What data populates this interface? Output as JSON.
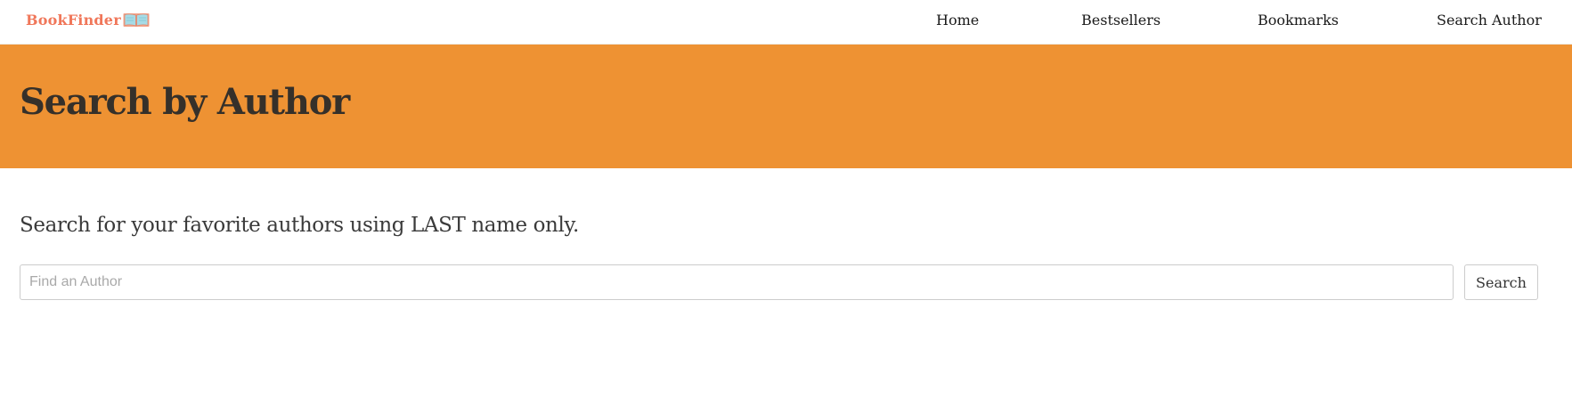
{
  "brand": {
    "name": "BookFinder",
    "icon": "open-book-icon",
    "color": "#f0775a"
  },
  "nav": {
    "items": [
      {
        "label": "Home"
      },
      {
        "label": "Bestsellers"
      },
      {
        "label": "Bookmarks"
      },
      {
        "label": "Search Author"
      }
    ]
  },
  "header": {
    "title": "Search by Author",
    "background": "#ee9233"
  },
  "main": {
    "lead": "Search for your favorite authors using LAST name only.",
    "search": {
      "placeholder": "Find an Author",
      "value": "",
      "button_label": "Search"
    }
  }
}
